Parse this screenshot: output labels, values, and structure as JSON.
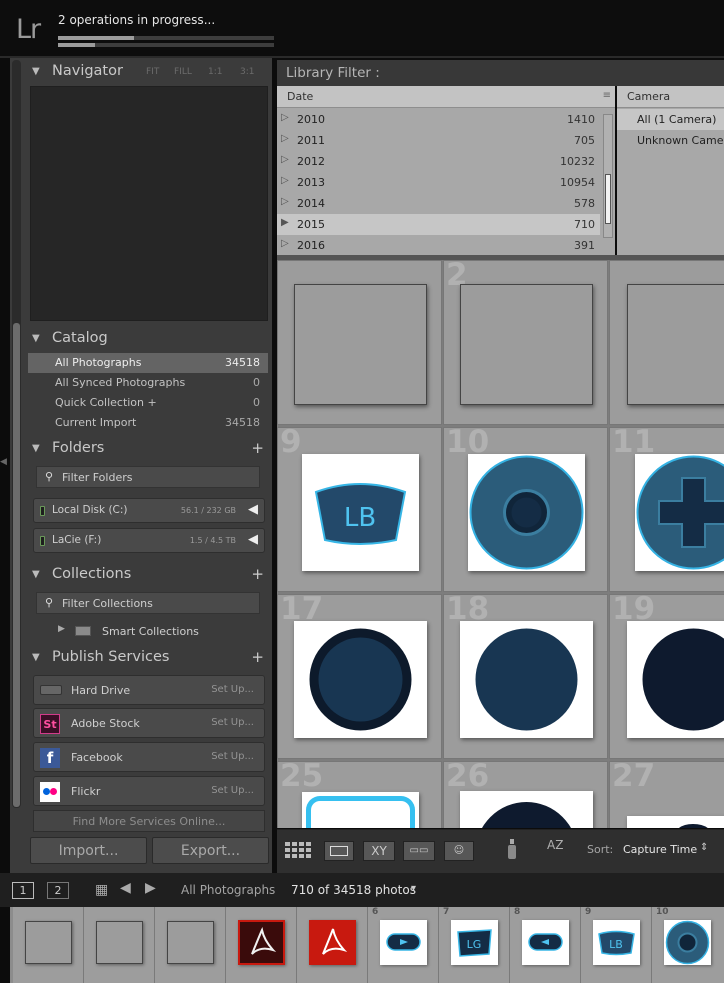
{
  "app": {
    "logo": "Lr",
    "status_text": "2 operations in progress...",
    "progress": [
      0.35,
      0.17
    ]
  },
  "left": {
    "navigator": {
      "title": "Navigator",
      "zoom": [
        "FIT",
        "FILL",
        "1:1",
        "3:1"
      ]
    },
    "catalog": {
      "title": "Catalog",
      "rows": [
        {
          "label": "All Photographs",
          "count": "34518"
        },
        {
          "label": "All Synced Photographs",
          "count": "0"
        },
        {
          "label": "Quick Collection  +",
          "count": "0"
        },
        {
          "label": "Current Import",
          "count": "34518"
        }
      ]
    },
    "folders": {
      "title": "Folders",
      "filter_label": "Filter Folders",
      "volumes": [
        {
          "name": "Local Disk (C:)",
          "size": "56.1 / 232 GB"
        },
        {
          "name": "LaCie (F:)",
          "size": "1.5 / 4.5 TB"
        }
      ]
    },
    "collections": {
      "title": "Collections",
      "filter_label": "Filter Collections",
      "smart": "Smart Collections"
    },
    "publish": {
      "title": "Publish Services",
      "services": [
        {
          "name": "Hard Drive",
          "action": "Set Up..."
        },
        {
          "name": "Adobe Stock",
          "action": "Set Up...",
          "icon_text": "St"
        },
        {
          "name": "Facebook",
          "action": "Set Up...",
          "icon_text": "f"
        },
        {
          "name": "Flickr",
          "action": "Set Up..."
        }
      ],
      "find_more": "Find More Services Online..."
    },
    "import_label": "Import...",
    "export_label": "Export..."
  },
  "filter": {
    "title": "Library Filter :",
    "date_header": "Date",
    "dates": [
      {
        "year": "2010",
        "count": "1410"
      },
      {
        "year": "2011",
        "count": "705"
      },
      {
        "year": "2012",
        "count": "10232"
      },
      {
        "year": "2013",
        "count": "10954"
      },
      {
        "year": "2014",
        "count": "578"
      },
      {
        "year": "2015",
        "count": "710"
      },
      {
        "year": "2016",
        "count": "391"
      }
    ],
    "camera_header": "Camera",
    "cameras": [
      "All (1 Camera)",
      "Unknown Camera"
    ]
  },
  "grid": {
    "numbers": [
      "2",
      "9",
      "10",
      "11",
      "17",
      "18",
      "19",
      "25",
      "26",
      "27"
    ],
    "thumb_labels": {
      "lb": "LB"
    }
  },
  "toolbar": {
    "sort_label": "Sort:",
    "sort_value": "Capture Time",
    "xy_label": "XY",
    "az_label": "AZ"
  },
  "filmbar": {
    "page1": "1",
    "page2": "2",
    "source": "All Photographs",
    "count": "710 of 34518 photos"
  },
  "filmstrip": {
    "numbers": [
      "6",
      "7",
      "8",
      "9",
      "10"
    ],
    "labels": {
      "lg": "LG",
      "lb": "LB"
    }
  },
  "colors": {
    "panel": "#3b3b3b",
    "accent_blue": "#2b5c7a",
    "navy": "#142c45",
    "adobe_red": "#c8190f",
    "facebook_blue": "#3b5998"
  }
}
